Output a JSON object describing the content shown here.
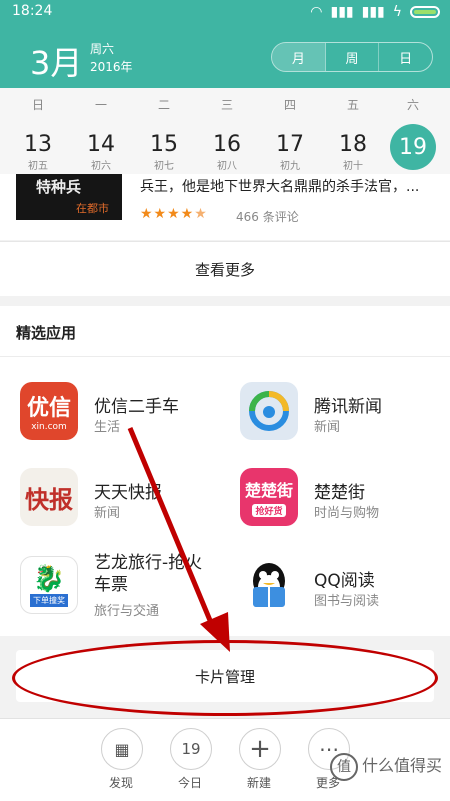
{
  "status": {
    "time": "18:24"
  },
  "header": {
    "month": "3月",
    "weekday": "周六",
    "year": "2016年",
    "views": [
      "月",
      "周",
      "日"
    ]
  },
  "week": {
    "weekdays": [
      "日",
      "一",
      "二",
      "三",
      "四",
      "五",
      "六"
    ],
    "dates": [
      "13",
      "14",
      "15",
      "16",
      "17",
      "18",
      "19"
    ],
    "lunar": [
      "初五",
      "初六",
      "初七",
      "初八",
      "初九",
      "初十",
      ""
    ]
  },
  "book": {
    "cover_text": "特种兵",
    "cover_sub": "在都市",
    "desc": "兵王，他是地下世界大名鼎鼎的杀手法官，...",
    "rating": 4.5,
    "reviews": "466 条评论"
  },
  "more_label": "查看更多",
  "apps": {
    "title": "精选应用",
    "items": [
      {
        "name": "优信二手车",
        "cat": "生活",
        "icon": "优信 xin.com",
        "color": "#e0462c"
      },
      {
        "name": "腾讯新闻",
        "cat": "新闻",
        "icon": "news-icon",
        "color": "#dfe8f2"
      },
      {
        "name": "天天快报",
        "cat": "新闻",
        "icon": "快报",
        "color": "#f3f0ea"
      },
      {
        "name": "楚楚街",
        "cat": "时尚与购物",
        "icon": "楚楚街",
        "color": "#e8356c"
      },
      {
        "name": "艺龙旅行-抢火车票",
        "cat": "旅行与交通",
        "icon": "dragon-icon",
        "color": "#ffffff"
      },
      {
        "name": "QQ阅读",
        "cat": "图书与阅读",
        "icon": "qq-read-icon",
        "color": "#4a8fe0"
      }
    ]
  },
  "manage_label": "卡片管理",
  "nav": [
    {
      "label": "发现",
      "glyph": "▦"
    },
    {
      "label": "今日",
      "glyph": "19"
    },
    {
      "label": "新建",
      "glyph": "+"
    },
    {
      "label": "更多",
      "glyph": "⋯"
    }
  ],
  "watermark": "什么值得买"
}
